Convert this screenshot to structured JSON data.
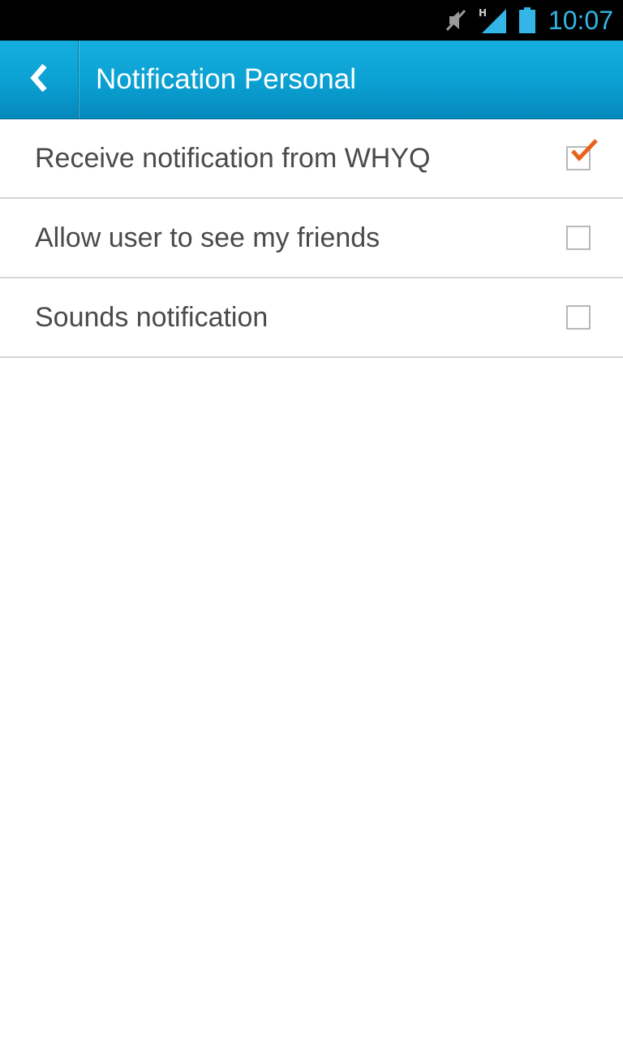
{
  "status_bar": {
    "time": "10:07",
    "icons": [
      "mute-icon",
      "signal-icon",
      "battery-icon"
    ],
    "network_type": "H"
  },
  "header": {
    "back_icon": "chevron-left-icon",
    "title": "Notification Personal"
  },
  "settings": [
    {
      "label": "Receive notification from WHYQ",
      "checked": true
    },
    {
      "label": "Allow user to see my friends",
      "checked": false
    },
    {
      "label": "Sounds notification",
      "checked": false
    }
  ],
  "colors": {
    "accent": "#33b5e5",
    "header_bg": "#0aa0d2",
    "check": "#e8621c"
  }
}
